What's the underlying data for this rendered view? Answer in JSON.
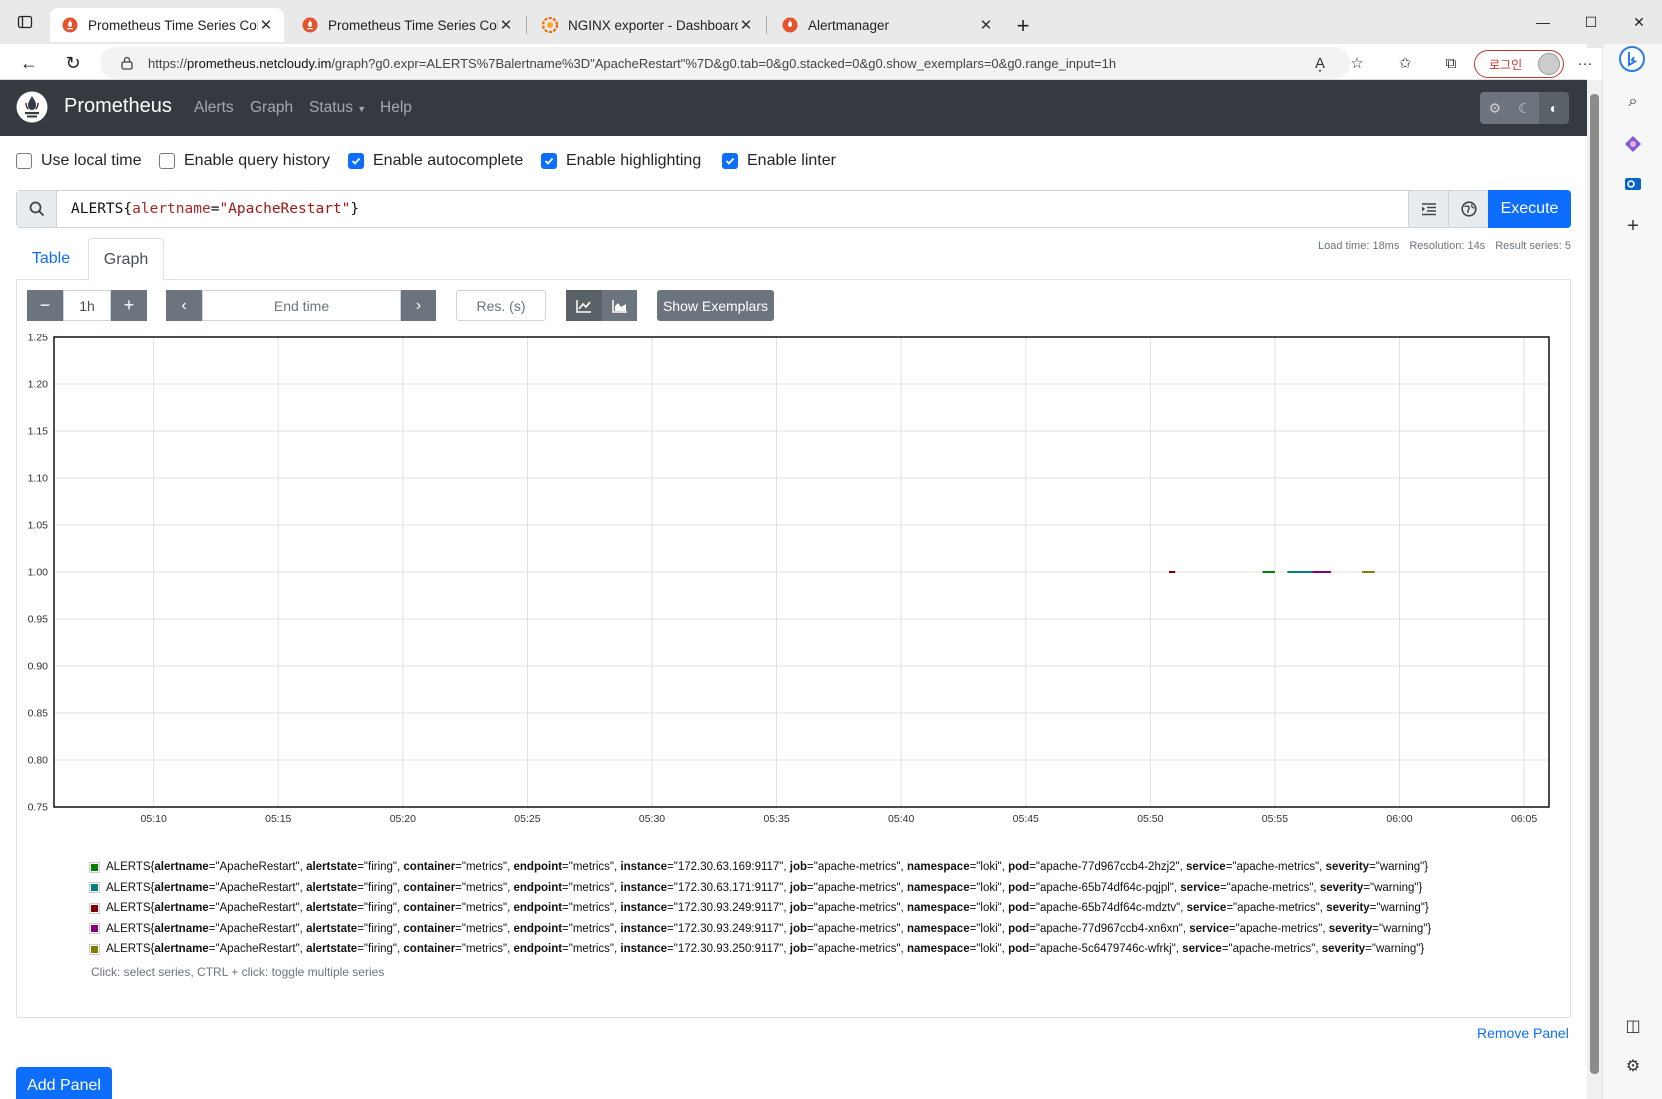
{
  "browser": {
    "tabs": [
      {
        "title": "Prometheus Time Series Collectio",
        "active": true
      },
      {
        "title": "Prometheus Time Series Collectio",
        "active": false
      },
      {
        "title": "NGINX exporter - Dashboards - G",
        "active": false
      },
      {
        "title": "Alertmanager",
        "active": false
      }
    ],
    "url_prefix": "https://",
    "url_host": "prometheus.netcloudy.im",
    "url_path": "/graph?g0.expr=ALERTS%7Balertname%3D\"ApacheRestart\"%7D&g0.tab=0&g0.stacked=0&g0.show_exemplars=0&g0.range_input=1h",
    "login_label": "로그인"
  },
  "nav": {
    "brand": "Prometheus",
    "links": [
      "Alerts",
      "Graph",
      "Status",
      "Help"
    ]
  },
  "options": [
    {
      "label": "Use local time",
      "checked": false
    },
    {
      "label": "Enable query history",
      "checked": false
    },
    {
      "label": "Enable autocomplete",
      "checked": true
    },
    {
      "label": "Enable highlighting",
      "checked": true
    },
    {
      "label": "Enable linter",
      "checked": true
    }
  ],
  "expression": {
    "metric": "ALERTS",
    "label_name": "alertname",
    "label_value": "\"ApacheRestart\"",
    "execute_label": "Execute"
  },
  "stats": {
    "load_time": "Load time: 18ms",
    "resolution": "Resolution: 14s",
    "result_series": "Result series: 5"
  },
  "panel_tabs": {
    "table": "Table",
    "graph": "Graph"
  },
  "graph_controls": {
    "range": "1h",
    "end_time_placeholder": "End time",
    "res_placeholder": "Res. (s)",
    "show_exemplars": "Show Exemplars"
  },
  "chart_data": {
    "type": "line",
    "title": "",
    "xlabel": "",
    "ylabel": "",
    "ylim": [
      0.75,
      1.25
    ],
    "y_ticks": [
      "1.25",
      "1.20",
      "1.15",
      "1.10",
      "1.05",
      "1.00",
      "0.95",
      "0.90",
      "0.85",
      "0.80",
      "0.75"
    ],
    "x_ticks": [
      "05:10",
      "05:15",
      "05:20",
      "05:25",
      "05:30",
      "05:35",
      "05:40",
      "05:45",
      "05:50",
      "05:55",
      "06:00",
      "06:05"
    ],
    "x_range_minutes": [
      "05:06",
      "06:06"
    ],
    "grid": true,
    "series": [
      {
        "color": "#008000",
        "segments": [
          {
            "start": "05:54:30",
            "end": "05:55:00",
            "value": 1
          }
        ]
      },
      {
        "color": "#008080",
        "segments": [
          {
            "start": "05:55:30",
            "end": "05:56:30",
            "value": 1
          }
        ]
      },
      {
        "color": "#800000",
        "segments": [
          {
            "start": "05:50:45",
            "end": "05:51:00",
            "value": 1
          }
        ]
      },
      {
        "color": "#800080",
        "segments": [
          {
            "start": "05:56:30",
            "end": "05:57:15",
            "value": 1
          }
        ]
      },
      {
        "color": "#808000",
        "segments": [
          {
            "start": "05:58:30",
            "end": "05:59:00",
            "value": 1
          }
        ]
      }
    ]
  },
  "legend": [
    {
      "color": "#008000",
      "instance": "172.30.63.169:9117",
      "pod": "apache-77d967ccb4-2hzj2"
    },
    {
      "color": "#008080",
      "instance": "172.30.63.171:9117",
      "pod": "apache-65b74df64c-pqjpl"
    },
    {
      "color": "#800000",
      "instance": "172.30.93.249:9117",
      "pod": "apache-65b74df64c-mdztv"
    },
    {
      "color": "#800080",
      "instance": "172.30.93.249:9117",
      "pod": "apache-77d967ccb4-xn6xn"
    },
    {
      "color": "#808000",
      "instance": "172.30.93.250:9117",
      "pod": "apache-5c6479746c-wfrkj"
    }
  ],
  "legend_common": {
    "metric": "ALERTS",
    "alertname": "\"ApacheRestart\"",
    "alertstate": "\"firing\"",
    "container": "\"metrics\"",
    "endpoint": "\"metrics\"",
    "job": "\"apache-metrics\"",
    "namespace": "\"loki\"",
    "service": "\"apache-metrics\"",
    "severity": "\"warning\""
  },
  "legend_hint": "Click: select series, CTRL + click: toggle multiple series",
  "remove_panel": "Remove Panel",
  "add_panel": "Add Panel"
}
